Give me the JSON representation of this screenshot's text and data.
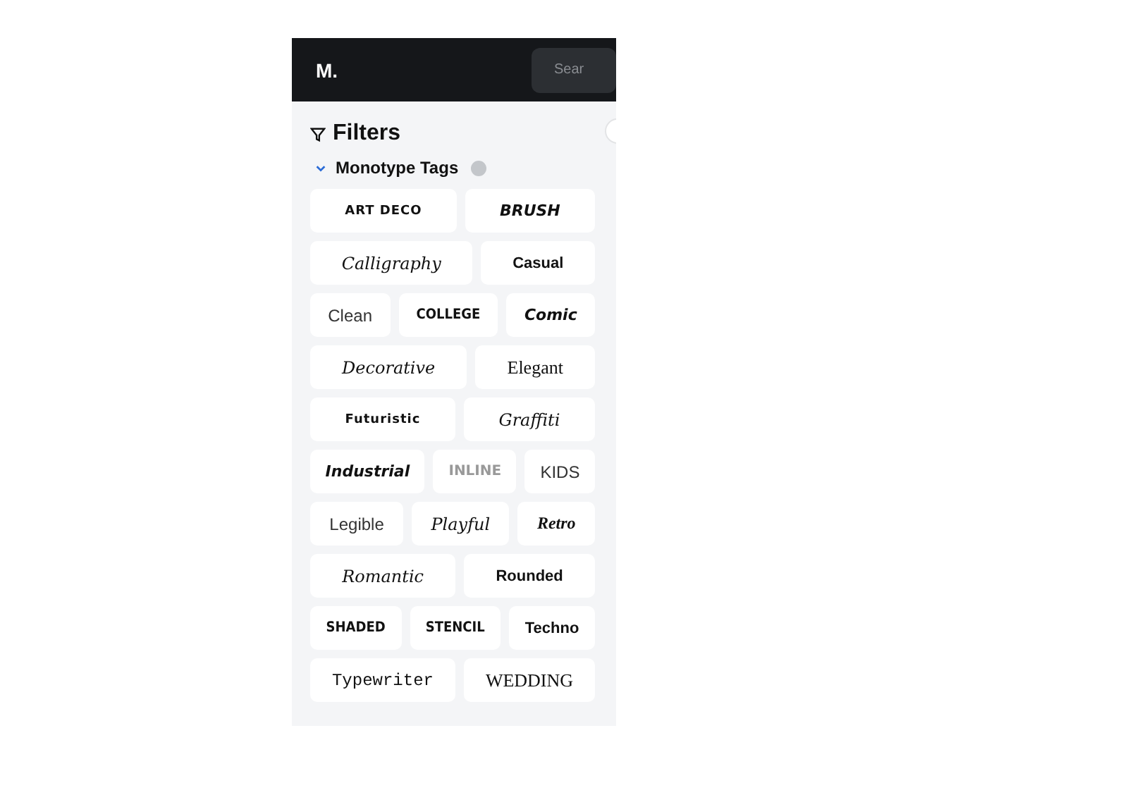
{
  "header": {
    "logo": "M.",
    "search": {
      "placeholder": "Sear"
    }
  },
  "filters": {
    "title": "Filters",
    "section": {
      "title": "Monotype Tags",
      "expanded": true,
      "rows": [
        [
          {
            "label": "ART DECO",
            "kind": "wide"
          },
          {
            "label": "BRUSH",
            "kind": "heavy"
          }
        ],
        [
          {
            "label": "Calligraphy",
            "kind": "script"
          },
          {
            "label": "Casual",
            "kind": "sans"
          }
        ],
        [
          {
            "label": "Clean",
            "kind": "light"
          },
          {
            "label": "COLLEGE",
            "kind": "condensed"
          },
          {
            "label": "Comic",
            "kind": "heavy"
          }
        ],
        [
          {
            "label": "Decorative",
            "kind": "script"
          },
          {
            "label": "Elegant",
            "kind": "serif"
          }
        ],
        [
          {
            "label": "Futuristic",
            "kind": "wide"
          },
          {
            "label": "Graffiti",
            "kind": "script"
          }
        ],
        [
          {
            "label": "Industrial",
            "kind": "heavy"
          },
          {
            "label": "INLINE",
            "kind": "grey"
          },
          {
            "label": "KIDS",
            "kind": "light"
          }
        ],
        [
          {
            "label": "Legible",
            "kind": "light"
          },
          {
            "label": "Playful",
            "kind": "script"
          },
          {
            "label": "Retro",
            "kind": "serifbold"
          }
        ],
        [
          {
            "label": "Romantic",
            "kind": "script"
          },
          {
            "label": "Rounded",
            "kind": "sans"
          }
        ],
        [
          {
            "label": "SHADED",
            "kind": "condensed"
          },
          {
            "label": "STENCIL",
            "kind": "condensed"
          },
          {
            "label": "Techno",
            "kind": "sans"
          }
        ],
        [
          {
            "label": "Typewriter",
            "kind": "mono"
          },
          {
            "label": "WEDDING",
            "kind": "serif"
          }
        ]
      ]
    }
  }
}
